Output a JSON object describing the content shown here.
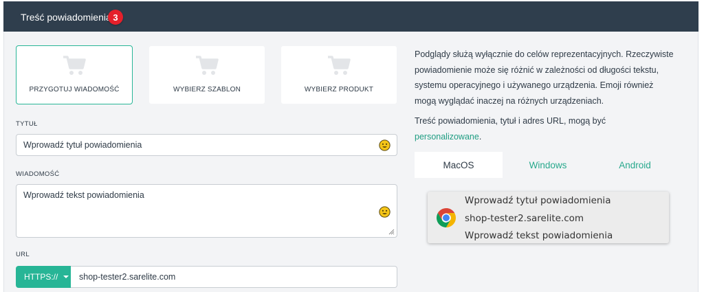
{
  "header": {
    "title": "Treść powiadomienia",
    "badge": "3"
  },
  "cards": [
    {
      "label": "PRZYGOTUJ WIADOMOŚĆ",
      "icon": "cart-icon",
      "active": true
    },
    {
      "label": "WYBIERZ SZABLON",
      "icon": "cart-icon",
      "active": false
    },
    {
      "label": "WYBIERZ PRODUKT",
      "icon": "cart-icon",
      "active": false
    }
  ],
  "title_field": {
    "label": "TYTUŁ",
    "placeholder": "Wprowadź tytuł powiadomienia"
  },
  "message_field": {
    "label": "WIADOMOŚĆ",
    "placeholder": "Wprowadź tekst powiadomienia"
  },
  "url_field": {
    "label": "URL",
    "protocol": "HTTPS://",
    "value": "shop-tester2.sarelite.com"
  },
  "info": {
    "paragraph1": "Podglądy służą wyłącznie do celów reprezentacyjnych. Rzeczywiste powiadomienie może się różnić w zależności od długości tekstu, systemu operacyjnego i używanego urządzenia. Emoji również mogą wyglądać inaczej na różnych urządzeniach.",
    "paragraph2_prefix": "Treść powiadomienia, tytuł i adres URL, mogą być",
    "paragraph2_link": "personalizowane",
    "paragraph2_suffix": "."
  },
  "tabs": [
    {
      "label": "MacOS",
      "active": true
    },
    {
      "label": "Windows",
      "active": false
    },
    {
      "label": "Android",
      "active": false
    }
  ],
  "preview": {
    "title": "Wprowadź tytuł powiadomienia",
    "domain": "shop-tester2.sarelite.com",
    "message": "Wprowadź tekst powiadomienia",
    "icon": "chrome-icon"
  },
  "colors": {
    "accent": "#27b596",
    "header_bg": "#2f3e4d",
    "badge": "#e5202b",
    "panel_bg": "#f3f4f6"
  }
}
